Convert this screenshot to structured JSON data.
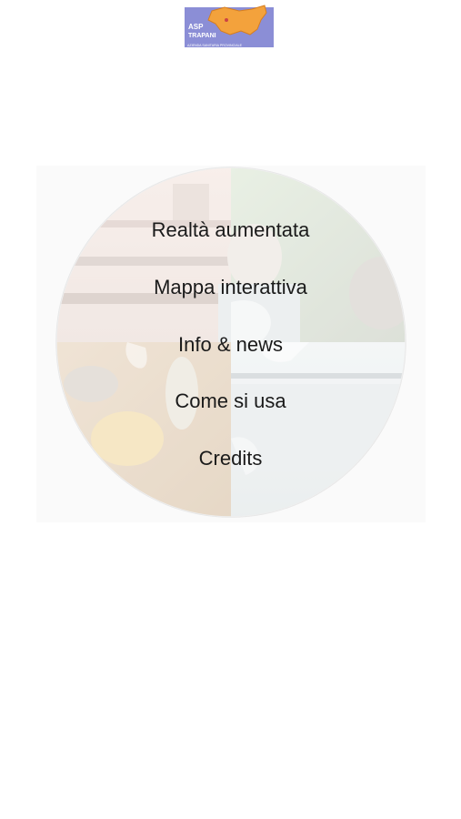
{
  "logo": {
    "brand_text_line1": "ASP",
    "brand_text_line2": "TRAPANI",
    "tagline": "AZIENDA SANITARIA PROVINCIALE",
    "colors": {
      "background": "#8b8ed6",
      "island": "#f3a23c"
    }
  },
  "menu": {
    "items": [
      {
        "label": "Realtà aumentata"
      },
      {
        "label": "Mappa interattiva"
      },
      {
        "label": "Info & news"
      },
      {
        "label": "Come si usa"
      },
      {
        "label": "Credits"
      }
    ]
  }
}
